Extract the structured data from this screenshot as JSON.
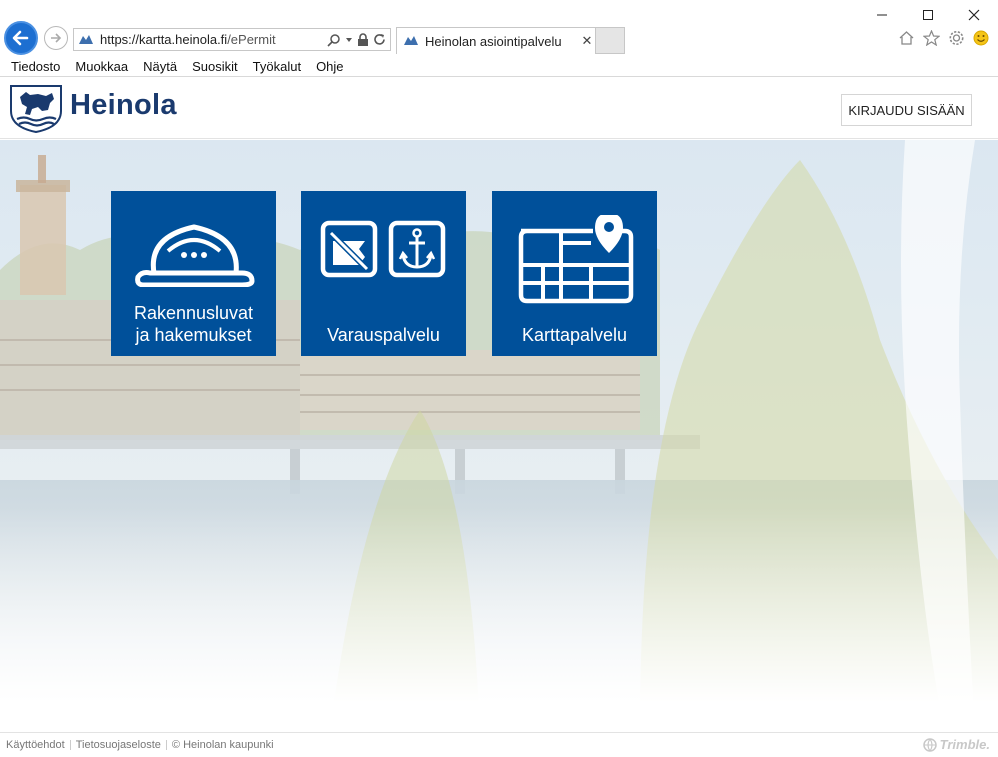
{
  "browser": {
    "url_host": "https://kartta.heinola.fi",
    "url_path": "/ePermit",
    "tab_title": "Heinolan asiointipalvelu",
    "tab_close": "✕",
    "menu": [
      "Tiedosto",
      "Muokkaa",
      "Näytä",
      "Suosikit",
      "Työkalut",
      "Ohje"
    ]
  },
  "header": {
    "logo_text": "Heinola",
    "login_label": "KIRJAUDU SISÄÄN"
  },
  "tiles": {
    "permits": {
      "label": "Rakennusluvat\nja hakemukset",
      "icon": "hard-hat-icon"
    },
    "booking": {
      "label": "Varauspalvelu",
      "icon": "reservation-icon"
    },
    "maps": {
      "label": "Karttapalvelu",
      "icon": "map-pin-icon"
    }
  },
  "footer": {
    "terms": "Käyttöehdot",
    "privacy": "Tietosuojaseloste",
    "copyright": "© Heinolan kaupunki",
    "vendor": "Trimble."
  },
  "colors": {
    "tile_bg": "#00509a",
    "brand_text": "#1a3a6e",
    "back_button": "#1d6fd1"
  }
}
